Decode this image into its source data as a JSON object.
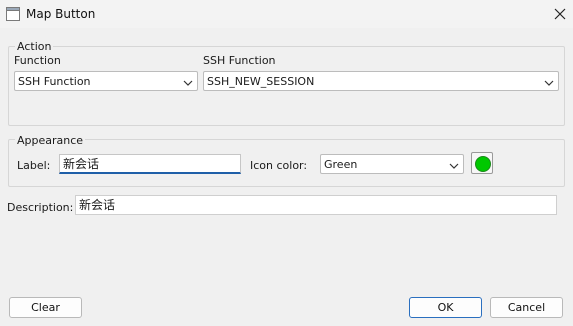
{
  "window": {
    "title": "Map Button"
  },
  "action": {
    "legend": "Action",
    "function_label": "Function",
    "function_value": "SSH Function",
    "ssh_function_label": "SSH Function",
    "ssh_function_value": "SSH_NEW_SESSION"
  },
  "appearance": {
    "legend": "Appearance",
    "label_label": "Label:",
    "label_value": "新会话",
    "icon_color_label": "Icon color:",
    "icon_color_value": "Green",
    "icon_color_hex": "#00c800"
  },
  "description": {
    "label": "Description:",
    "value": "新会话"
  },
  "buttons": {
    "clear": "Clear",
    "ok": "OK",
    "cancel": "Cancel"
  },
  "colors": {
    "accent": "#1f5fa8",
    "default_button_border": "#2a6fbf"
  },
  "icons": {
    "app": "window-app-icon",
    "close": "close-icon",
    "dropdown": "chevron-down-icon"
  }
}
